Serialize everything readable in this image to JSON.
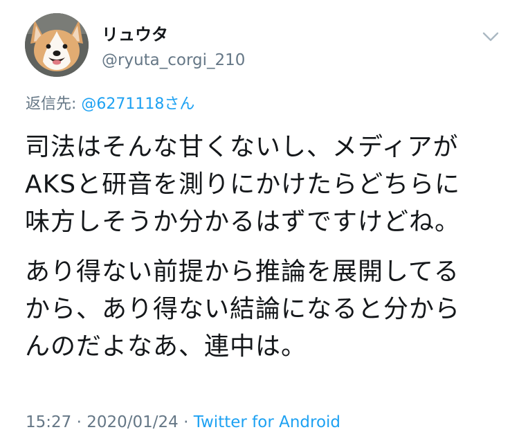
{
  "tweet": {
    "display_name": "リュウタ",
    "handle": "@ryuta_corgi_210",
    "reply_prefix": "返信先: ",
    "reply_to": "@6271118さん",
    "paragraphs": [
      [
        "司法はそんな甘くないし、メディアが",
        "AKSと研音を測りにかけたらどちらに",
        "味方しそうか分かるはずですけどね。"
      ],
      [
        "あり得ない前提から推論を展開してる",
        "から、あり得ない結論になると分から",
        "んのだよなあ、連中は。"
      ]
    ],
    "time": "15:27",
    "separator": " · ",
    "date": "2020/01/24",
    "source": "Twitter for Android"
  },
  "icons": {
    "avatar": "corgi-avatar-icon",
    "menu": "chevron-down-icon"
  },
  "colors": {
    "text": "#14171a",
    "secondary": "#657786",
    "link": "#1da1f2",
    "background": "#ffffff"
  }
}
